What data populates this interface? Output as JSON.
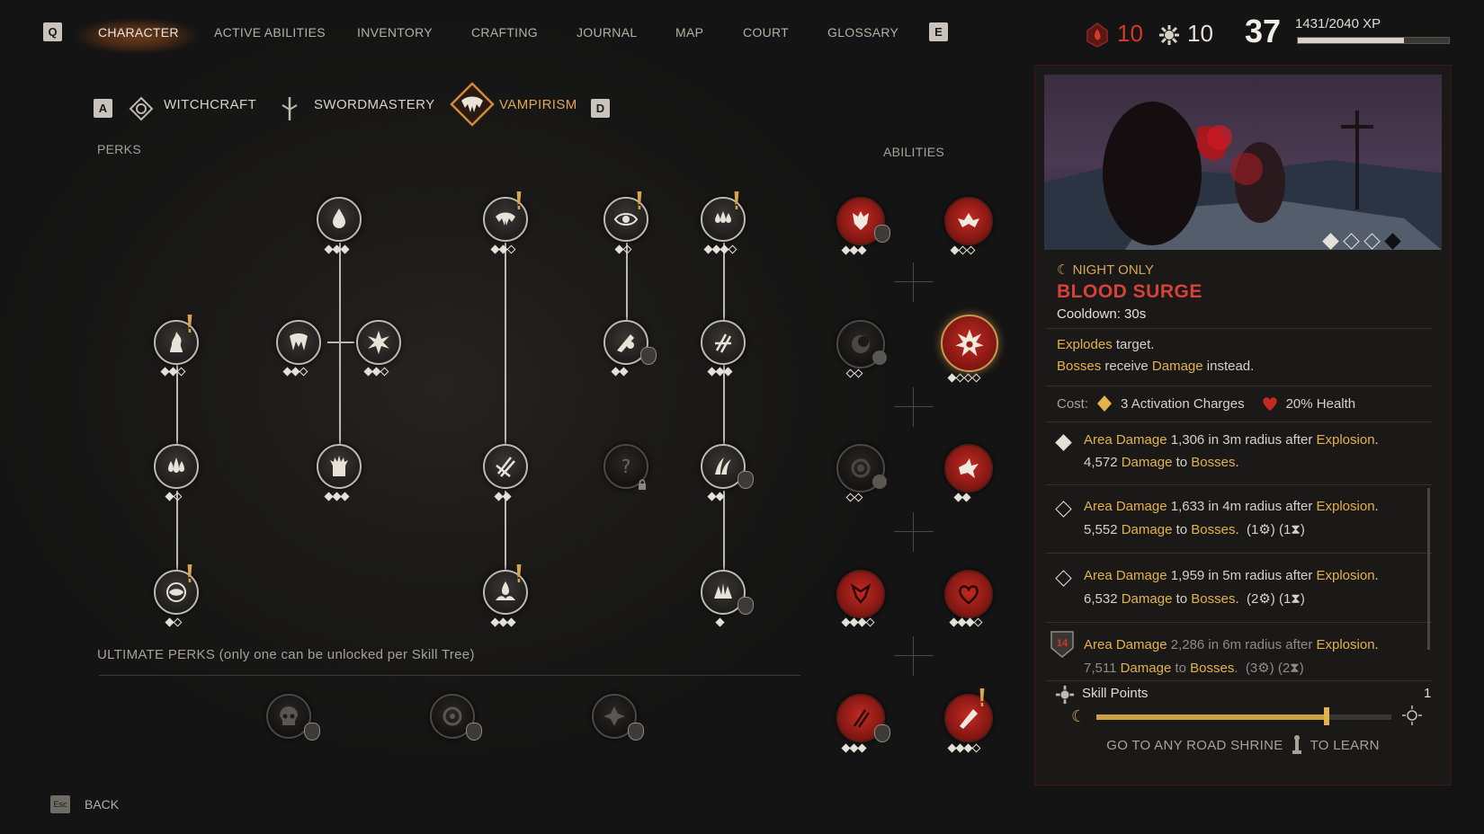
{
  "nav": {
    "left_key": "Q",
    "right_key": "E",
    "tabs": [
      "CHARACTER",
      "ACTIVE ABILITIES",
      "INVENTORY",
      "CRAFTING",
      "JOURNAL",
      "MAP",
      "COURT",
      "GLOSSARY"
    ],
    "active_tab": "CHARACTER"
  },
  "stats": {
    "blood_points": "10",
    "skill_points": "10",
    "level": "37",
    "xp": "1431/2040 XP",
    "xp_progress": 0.701
  },
  "tree_tabs": {
    "left_key": "A",
    "right_key": "D",
    "items": [
      {
        "label": "WITCHCRAFT",
        "icon": "witchcraft-icon"
      },
      {
        "label": "SWORDMASTERY",
        "icon": "sword-icon"
      },
      {
        "label": "VAMPIRISM",
        "icon": "fang-icon"
      }
    ],
    "active": "VAMPIRISM"
  },
  "sections": {
    "perks": "PERKS",
    "abilities": "ABILITIES",
    "ultimate": "ULTIMATE PERKS (only one can be unlocked per Skill Tree)"
  },
  "detail": {
    "tag": "NIGHT ONLY",
    "title": "BLOOD SURGE",
    "cooldown": "Cooldown: 30s",
    "desc_line1_hl": "Explodes",
    "desc_line1_rest": " target.",
    "desc_line2_hl1": "Bosses",
    "desc_line2_mid": " receive ",
    "desc_line2_hl2": "Damage",
    "desc_line2_rest": " instead.",
    "cost_label": "Cost:",
    "cost_charges": "3 Activation Charges",
    "cost_health": "20% Health",
    "levels": [
      {
        "hl1": "Area Damage",
        "t1": " 1,306 in 3m radius after ",
        "hl2": "Explosion",
        "t2": ".",
        "l2a": "4,572 ",
        "hl3": "Damage",
        "l2b": " to ",
        "hl4": "Bosses",
        "l2c": ".",
        "req": ""
      },
      {
        "hl1": "Area Damage",
        "t1": " 1,633 in 4m radius after ",
        "hl2": "Explosion",
        "t2": ".",
        "l2a": "5,552 ",
        "hl3": "Damage",
        "l2b": " to ",
        "hl4": "Bosses",
        "l2c": ".",
        "req": "(1⚙) (1⧗)"
      },
      {
        "hl1": "Area Damage",
        "t1": " 1,959 in 5m radius after ",
        "hl2": "Explosion",
        "t2": ".",
        "l2a": "6,532 ",
        "hl3": "Damage",
        "l2b": " to ",
        "hl4": "Bosses",
        "l2c": ".",
        "req": "(2⚙) (1⧗)"
      },
      {
        "hl1": "Area Damage",
        "t1": " 2,286 in 6m radius after ",
        "hl2": "Explosion",
        "t2": ".",
        "l2a": "7,511 ",
        "hl3": "Damage",
        "l2b": " to ",
        "hl4": "Bosses",
        "l2c": ".",
        "req": "(3⚙) (2⧗)",
        "level_req": "14"
      }
    ],
    "skill_points_label": "Skill Points",
    "skill_points_value": "1",
    "day_night_progress": 0.78,
    "hint_left": "GO TO ANY ROAD SHRINE",
    "hint_right": "TO LEARN"
  },
  "back": {
    "key": "Esc",
    "label": "BACK"
  },
  "colors": {
    "accent_gold": "#e3b24c",
    "blood_red": "#c32a22",
    "title_red": "#d8413a"
  }
}
